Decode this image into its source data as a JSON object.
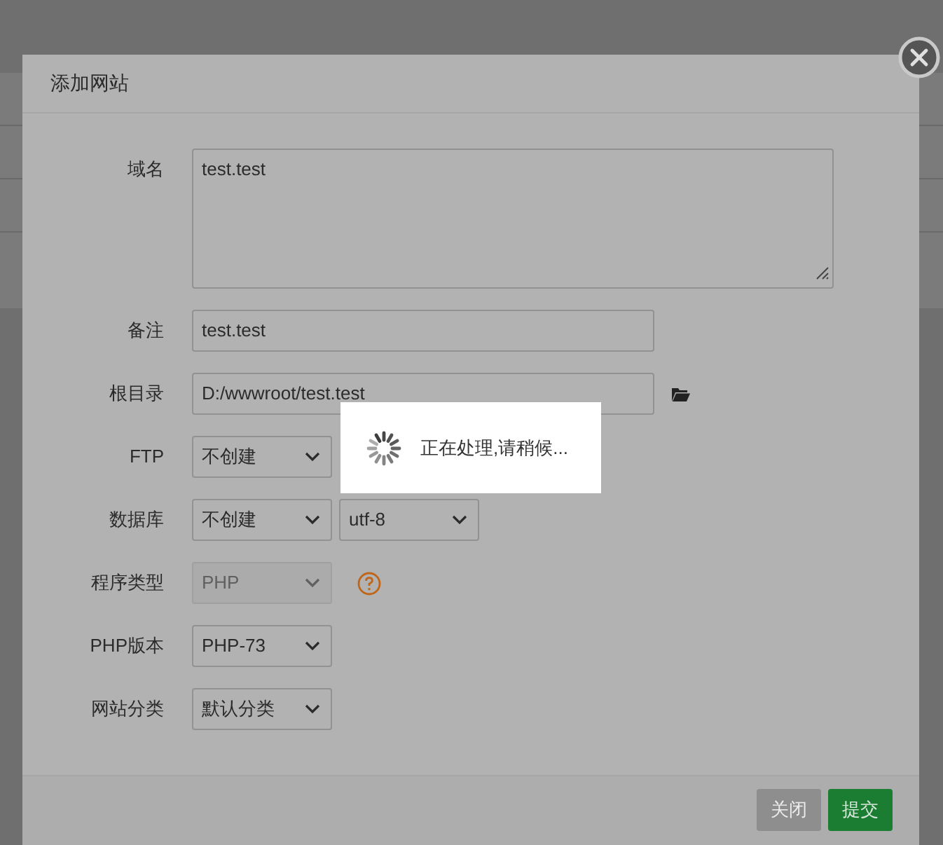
{
  "dialog": {
    "title": "添加网站",
    "fields": [
      {
        "kind": "textarea",
        "label": "域名",
        "value": "test.test",
        "help": false
      },
      {
        "kind": "text",
        "label": "备注",
        "value": "test.test",
        "help": false
      },
      {
        "kind": "path",
        "label": "根目录",
        "value": "D:/wwwroot/test.test",
        "help": false
      },
      {
        "kind": "select",
        "label": "FTP",
        "selects": [
          {
            "value": "不创建",
            "disabled": false
          }
        ],
        "help": false
      },
      {
        "kind": "select",
        "label": "数据库",
        "selects": [
          {
            "value": "不创建",
            "disabled": false
          },
          {
            "value": "utf-8",
            "disabled": false
          }
        ],
        "help": false
      },
      {
        "kind": "select",
        "label": "程序类型",
        "selects": [
          {
            "value": "PHP",
            "disabled": true
          }
        ],
        "help": true
      },
      {
        "kind": "select",
        "label": "PHP版本",
        "selects": [
          {
            "value": "PHP-73",
            "disabled": false
          }
        ],
        "help": false
      },
      {
        "kind": "select",
        "label": "网站分类",
        "selects": [
          {
            "value": "默认分类",
            "disabled": false
          }
        ],
        "help": false
      }
    ],
    "buttons": [
      {
        "label": "关闭",
        "kind": "secondary"
      },
      {
        "label": "提交",
        "kind": "primary"
      }
    ]
  },
  "loading": {
    "message": "正在处理,请稍候..."
  }
}
